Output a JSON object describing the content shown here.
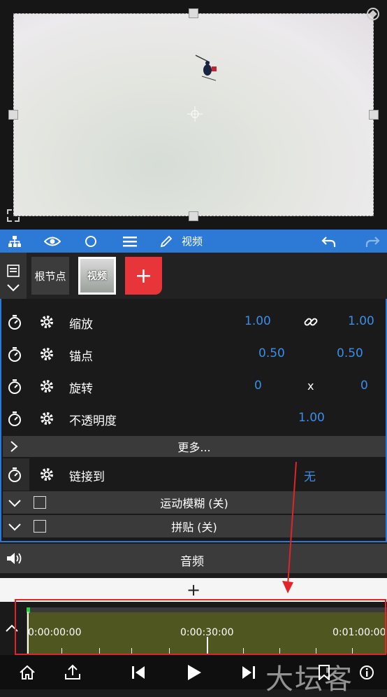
{
  "toolbar": {
    "label": "视频"
  },
  "nodes": {
    "root": "根节点",
    "video": "视频",
    "add": "+"
  },
  "props": {
    "scale": {
      "label": "缩放",
      "v1": "1.00",
      "v2": "1.00"
    },
    "anchor": {
      "label": "锚点",
      "v1": "0.50",
      "v2": "0.50"
    },
    "rotate": {
      "label": "旋转",
      "v1": "0",
      "sep": "x",
      "v2": "0"
    },
    "opacity": {
      "label": "不透明度",
      "v1": "1.00"
    },
    "more": "更多...",
    "link": {
      "label": "链接到",
      "value": "无"
    },
    "motion_blur": "运动模糊 (关)",
    "tile": "拼贴 (关)"
  },
  "audio": {
    "label": "音频"
  },
  "add_track": "+",
  "timeline": {
    "t0": "0:00:00:00",
    "t1": "0:00:30:00",
    "t2": "0:01:00:00"
  },
  "watermark": "大坛客",
  "colors": {
    "accent": "#2c7ad6",
    "value": "#3b8ee8",
    "add": "#e8353a",
    "track": "#4f561f",
    "highlight": "#e0242a"
  }
}
